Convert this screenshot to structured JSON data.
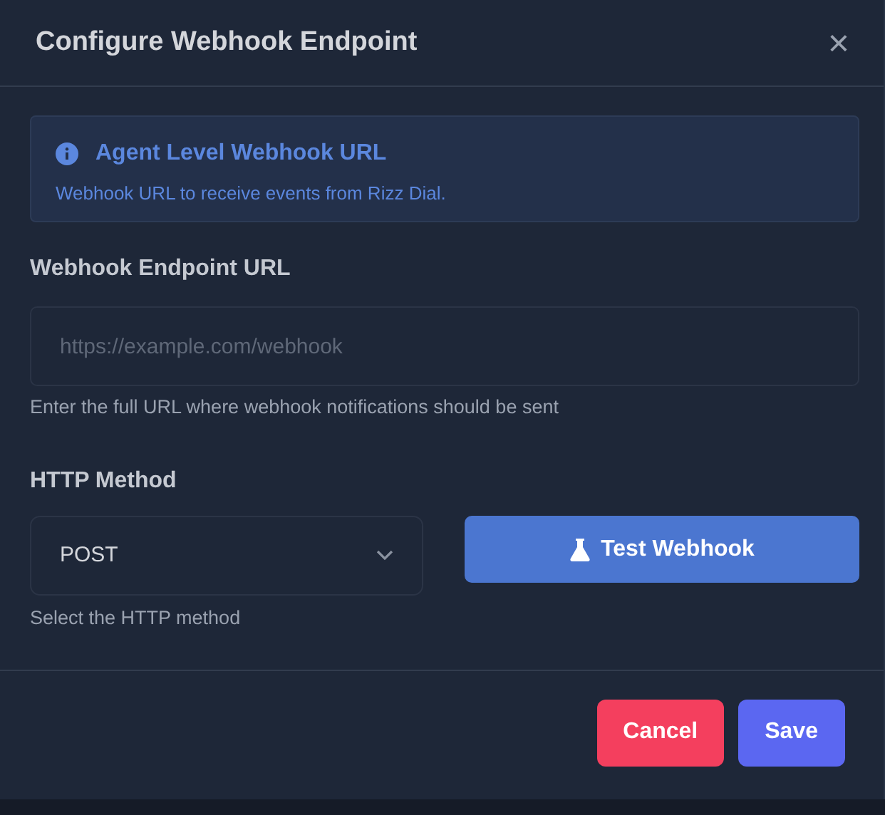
{
  "dialog": {
    "title": "Configure Webhook Endpoint",
    "close": "×"
  },
  "info": {
    "title": "Agent Level Webhook URL",
    "text": "Webhook URL to receive events from Rizz Dial."
  },
  "url_field": {
    "label": "Webhook Endpoint URL",
    "placeholder": "https://example.com/webhook",
    "help": "Enter the full URL where webhook notifications should be sent"
  },
  "method_field": {
    "label": "HTTP Method",
    "value": "POST",
    "help": "Select the HTTP method"
  },
  "test_button": "Test Webhook",
  "buttons": [
    {
      "label": "Cancel",
      "kind": "danger"
    },
    {
      "label": "Save",
      "kind": "primary"
    }
  ]
}
